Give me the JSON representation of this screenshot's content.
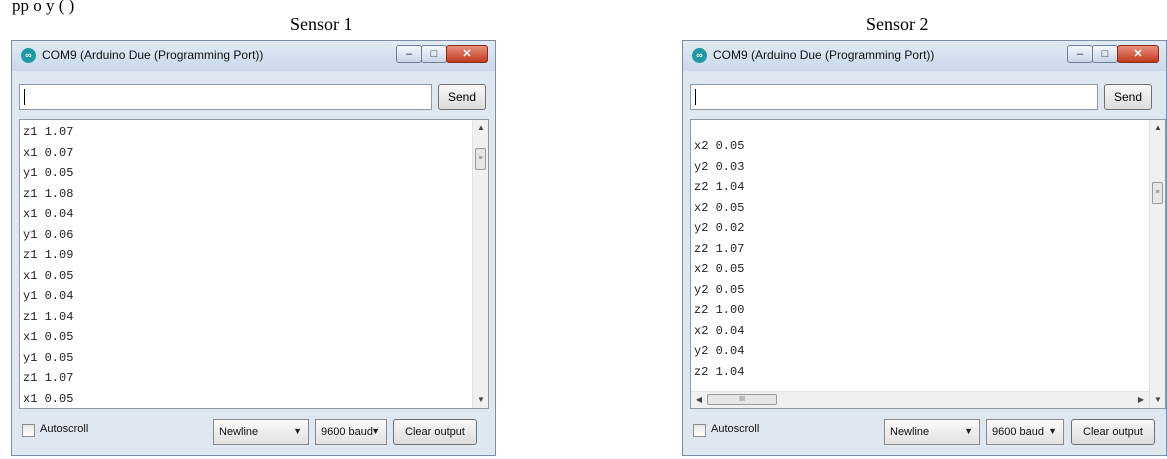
{
  "top_text": "pp    o  y (          )",
  "panels": [
    {
      "caption": "Sensor 1",
      "window_title": "COM9 (Arduino Due (Programming Port))",
      "app_icon": "infinity-icon",
      "send_label": "Send",
      "output_lines": [
        "z1 1.07",
        "x1 0.07",
        "y1 0.05",
        "z1 1.08",
        "x1 0.04",
        "y1 0.06",
        "z1 1.09",
        "x1 0.05",
        "y1 0.04",
        "z1 1.04",
        "x1 0.05",
        "y1 0.05",
        "z1 1.07",
        "x1 0.05"
      ],
      "autoscroll_label": "Autoscroll",
      "line_ending": "Newline",
      "baud_rate": "9600 baud",
      "clear_label": "Clear output"
    },
    {
      "caption": "Sensor 2",
      "window_title": "COM9 (Arduino Due (Programming Port))",
      "app_icon": "infinity-icon",
      "send_label": "Send",
      "output_lines": [
        "x2 0.05",
        "y2 0.03",
        "z2 1.04",
        "x2 0.05",
        "y2 0.02",
        "z2 1.07",
        "x2 0.05",
        "y2 0.05",
        "z2 1.00",
        "x2 0.04",
        "y2 0.04",
        "z2 1.04"
      ],
      "autoscroll_label": "Autoscroll",
      "line_ending": "Newline",
      "baud_rate": "9600 baud",
      "clear_label": "Clear output"
    }
  ],
  "colors": {
    "close_button": "#c2391f",
    "title_bar": "#d6e3f1",
    "app_icon": "#1f9aa3"
  }
}
